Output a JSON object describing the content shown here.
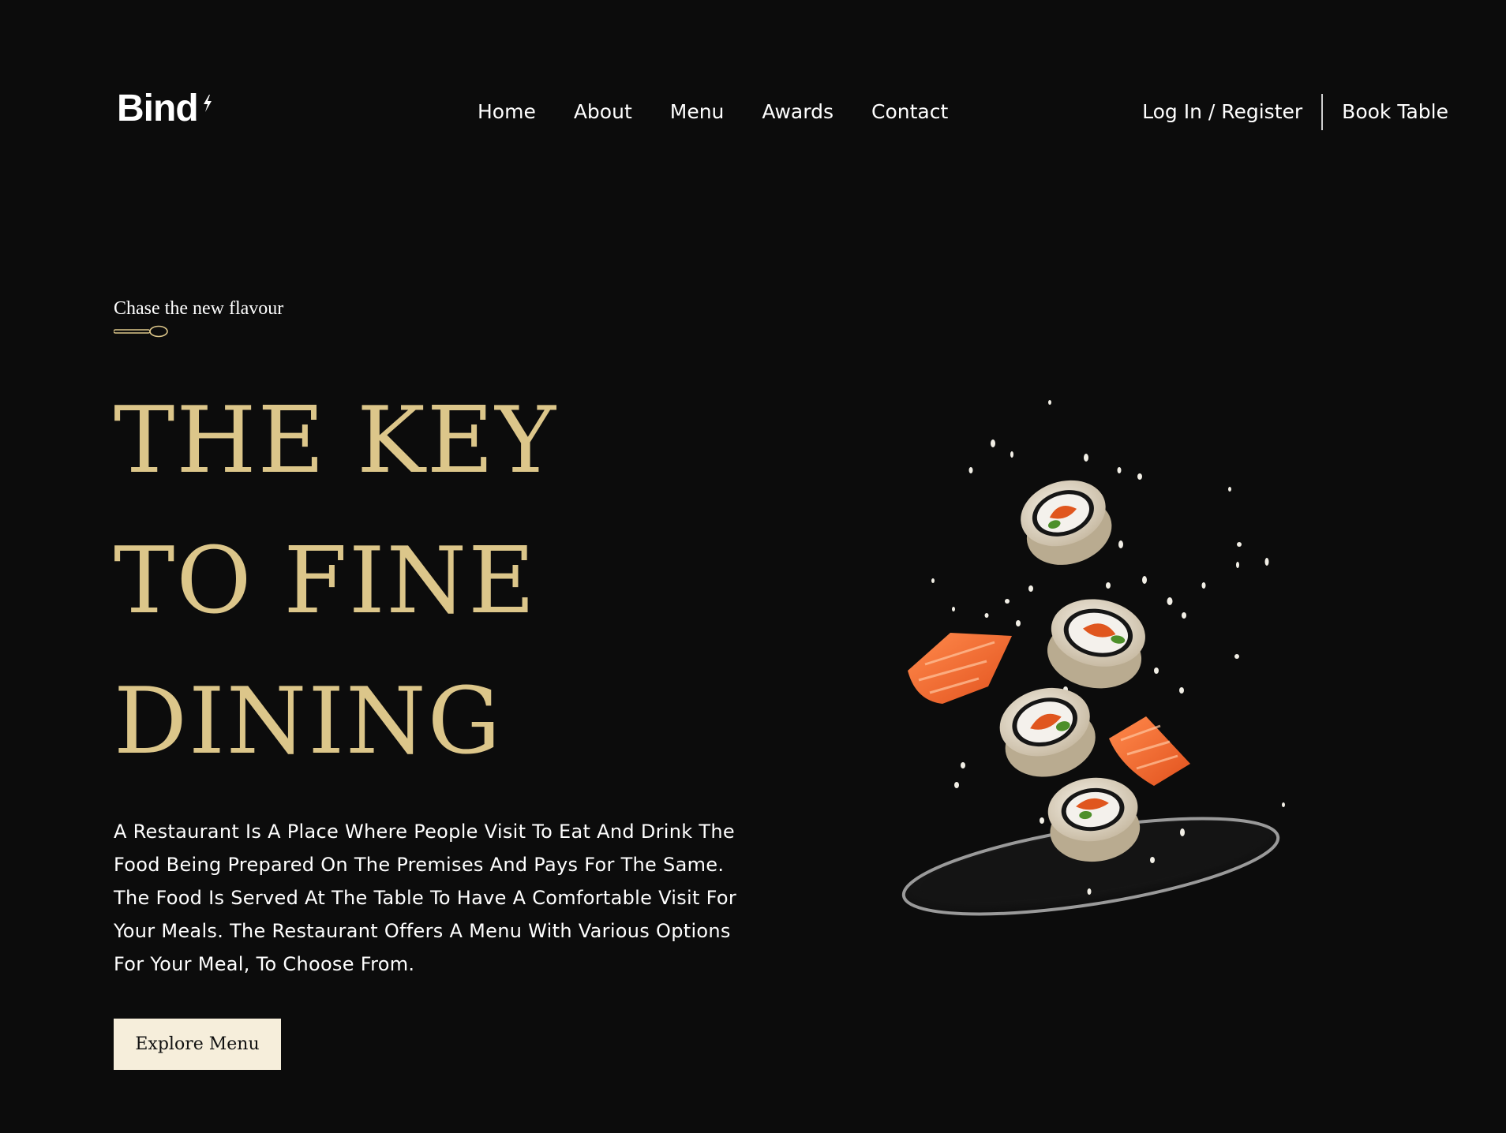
{
  "header": {
    "logo_text": "Bind",
    "nav": [
      {
        "label": "Home"
      },
      {
        "label": "About"
      },
      {
        "label": "Menu"
      },
      {
        "label": "Awards"
      },
      {
        "label": "Contact"
      }
    ],
    "login_label": "Log In / Register",
    "book_label": "Book Table"
  },
  "hero": {
    "eyebrow": "Chase the new flavour",
    "headline": [
      "THE KEY",
      "TO FINE",
      "DINING"
    ],
    "description": "A Restaurant Is A Place Where People Visit To Eat And Drink The Food Being Prepared On The Premises And Pays For The Same. The Food Is Served At The Table To Have A Comfortable Visit For Your Meals. The Restaurant Offers A Menu With Various Options For Your Meal, To Choose From.",
    "cta_label": "Explore Menu"
  },
  "colors": {
    "background": "#0c0c0c",
    "accent_gold": "#dcc68a",
    "button_bg": "#f6eedb",
    "text": "#ffffff"
  },
  "icons": {
    "logo_accent": "spark-icon",
    "divider": "spoon-icon"
  }
}
